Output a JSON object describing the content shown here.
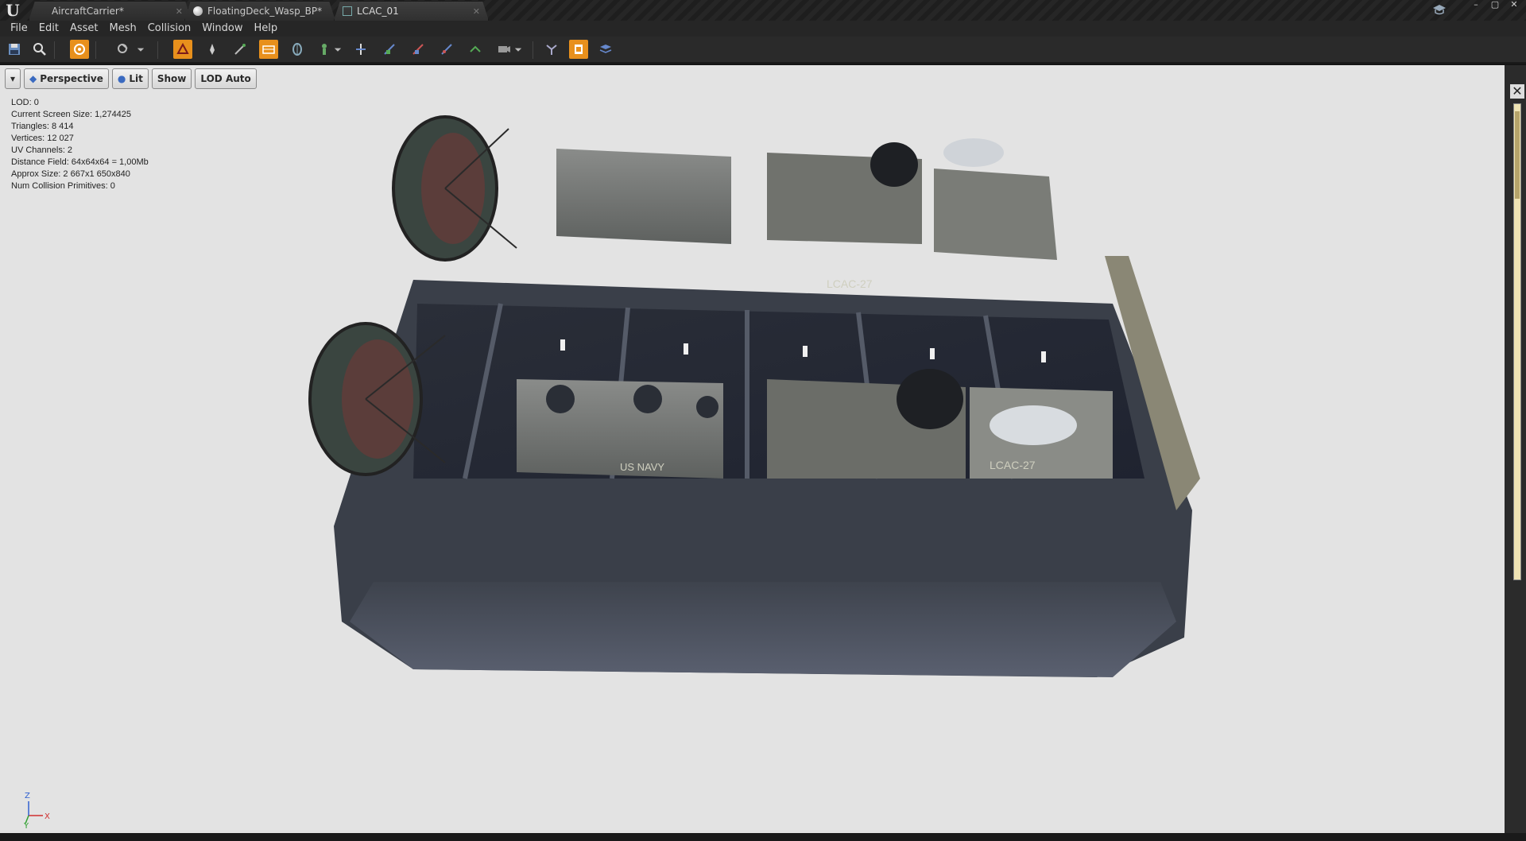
{
  "tabs": [
    {
      "label": "AircraftCarrier*",
      "active": false,
      "icon": "blueprint-icon"
    },
    {
      "label": "FloatingDeck_Wasp_BP*",
      "active": false,
      "icon": "sphere-icon"
    },
    {
      "label": "LCAC_01",
      "active": true,
      "icon": "static-mesh-icon"
    }
  ],
  "menu": [
    "File",
    "Edit",
    "Asset",
    "Mesh",
    "Collision",
    "Window",
    "Help"
  ],
  "toolbar_icons": [
    "save-icon",
    "browse-icon",
    "reimport-icon",
    "sockets-icon",
    "wireframe-icon",
    "vertex-color-icon",
    "grid-icon",
    "bounds-icon",
    "collision-icon",
    "pivot-icon",
    "normals-icon",
    "tangents-icon",
    "binormals-icon",
    "uv-icon",
    "additional-data-icon",
    "camera-icon",
    "lod-icon",
    "layers-icon"
  ],
  "viewport": {
    "perspective": "Perspective",
    "lit": "Lit",
    "show": "Show",
    "lod": "LOD Auto"
  },
  "stats": [
    "LOD:  0",
    "Current Screen Size:  1,274425",
    "Triangles:  8 414",
    "Vertices:  12 027",
    "UV Channels:  2",
    "Distance Field:  64x64x64 = 1,00Mb",
    "Approx Size: 2 667x1 650x840",
    "Num Collision Primitives:  0"
  ],
  "axis": {
    "z": "Z",
    "x": "X",
    "y": "Y"
  },
  "colors": {
    "accent": "#e8901c",
    "viewport_bg": "#e3e3e3",
    "hull": "#4a4f5a"
  }
}
